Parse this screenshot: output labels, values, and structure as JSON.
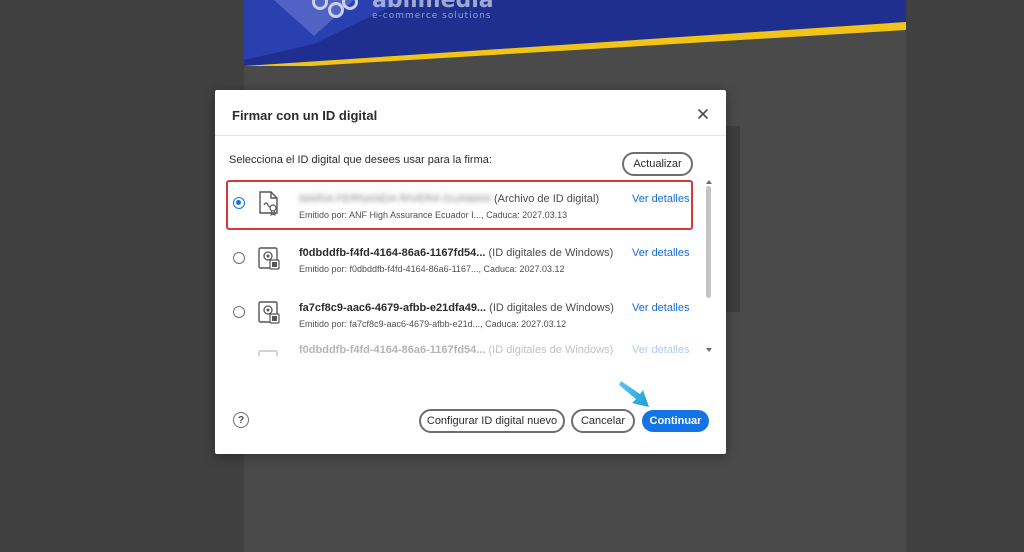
{
  "background": {
    "brand_name": "abiimedia",
    "brand_tagline": "e-commerce solutions"
  },
  "dialog": {
    "title": "Firmar con un ID digital",
    "prompt": "Selecciona el ID digital que desees usar para la firma:",
    "refresh_label": "Actualizar",
    "ids": [
      {
        "name": "MARIA FERNANDA RIVERA GUAMAN",
        "name_redacted": true,
        "type": "(Archivo de ID digital)",
        "issued": "Emitido por: ANF High Assurance Ecuador I..., Caduca: 2027.03.13",
        "details": "Ver detalles",
        "selected": true
      },
      {
        "name": "f0dbddfb-f4fd-4164-86a6-1167fd54...",
        "type": "(ID digitales de Windows)",
        "issued": "Emitido por: f0dbddfb-f4fd-4164-86a6-1167..., Caduca: 2027.03.12",
        "details": "Ver detalles",
        "selected": false
      },
      {
        "name": "fa7cf8c9-aac6-4679-afbb-e21dfa49...",
        "type": "(ID digitales de Windows)",
        "issued": "Emitido por: fa7cf8c9-aac6-4679-afbb-e21d..., Caduca: 2027.03.12",
        "details": "Ver detalles",
        "selected": false
      },
      {
        "name": "f0dbddfb-f4fd-4164-86a6-1167fd54...",
        "type": "(ID digitales de Windows)",
        "issued": "",
        "details": "Ver detalles",
        "selected": false
      }
    ],
    "help_label": "?",
    "configure_label": "Configurar ID digital nuevo",
    "cancel_label": "Cancelar",
    "continue_label": "Continuar"
  },
  "colors": {
    "accent": "#1473e6",
    "highlight_border": "#d93838",
    "pointer_arrow": "#29a8e0"
  }
}
